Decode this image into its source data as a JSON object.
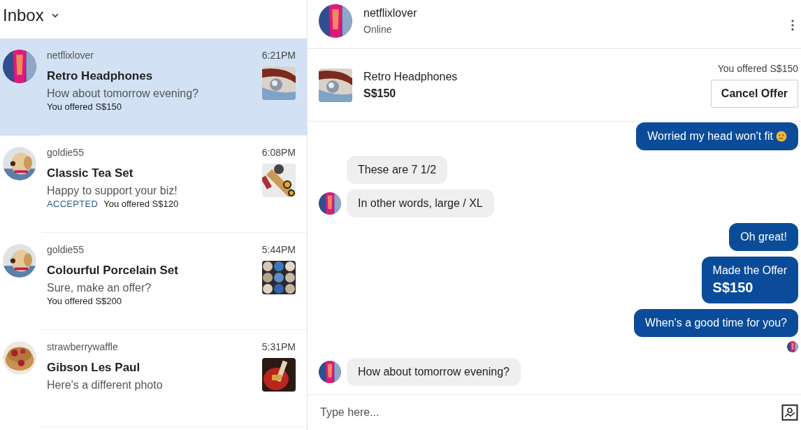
{
  "inbox": {
    "title": "Inbox"
  },
  "conversations": [
    {
      "username": "netflixlover",
      "time": "6:21PM",
      "item": "Retro Headphones",
      "last_message": "How about tomorrow evening?",
      "offer": "You offered S$150",
      "selected": true
    },
    {
      "username": "goldie55",
      "time": "6:08PM",
      "item": "Classic Tea Set",
      "last_message": "Happy to support your biz!",
      "status": "ACCEPTED",
      "offer": "You offered S$120",
      "selected": false
    },
    {
      "username": "goldie55",
      "time": "5:44PM",
      "item": "Colourful Porcelain Set",
      "last_message": "Sure, make an offer?",
      "offer": "You offered S$200",
      "selected": false
    },
    {
      "username": "strawberrywaffle",
      "time": "5:31PM",
      "item": "Gibson Les Paul",
      "last_message": "Here's a different photo",
      "selected": false
    }
  ],
  "chat": {
    "username": "netflixlover",
    "presence": "Online",
    "listing": {
      "title": "Retro Headphones",
      "price": "S$150",
      "offer_note": "You offered S$150",
      "action": "Cancel Offer"
    },
    "messages": [
      {
        "kind": "sent",
        "text": "Worried my head won't fit",
        "emoji": true
      },
      {
        "kind": "received",
        "text": "These are 7 1/2",
        "avatar": false
      },
      {
        "kind": "received",
        "text": "In other words, large / XL",
        "avatar": true
      },
      {
        "kind": "sent",
        "text": "Oh great!",
        "emoji": false
      },
      {
        "kind": "sent_offer",
        "text": "Made the Offer",
        "amount": "S$150"
      },
      {
        "kind": "sent",
        "text": "When's a good time for you?",
        "emoji": false
      },
      {
        "kind": "read_receipt"
      },
      {
        "kind": "received",
        "text": "How about tomorrow evening?",
        "avatar": true
      }
    ],
    "composer": {
      "placeholder": "Type here..."
    }
  }
}
